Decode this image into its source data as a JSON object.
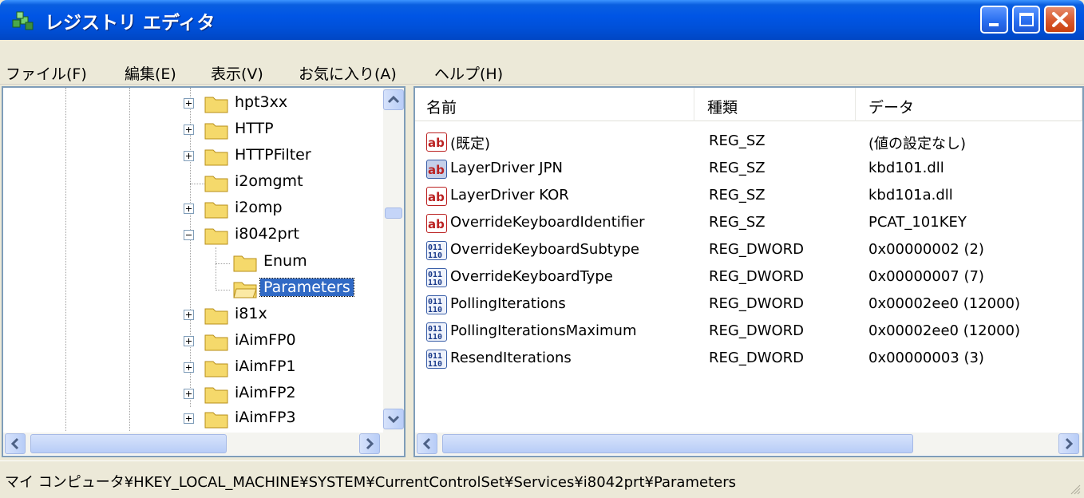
{
  "window": {
    "title": "レジストリ エディタ"
  },
  "menu": {
    "file": "ファイル(F)",
    "edit": "編集(E)",
    "view": "表示(V)",
    "favorites": "お気に入り(A)",
    "help": "ヘルプ(H)"
  },
  "tree": {
    "items": [
      {
        "label": "hpt3xx",
        "expander": "plus"
      },
      {
        "label": "HTTP",
        "expander": "plus"
      },
      {
        "label": "HTTPFilter",
        "expander": "plus"
      },
      {
        "label": "i2omgmt",
        "expander": "none"
      },
      {
        "label": "i2omp",
        "expander": "plus"
      },
      {
        "label": "i8042prt",
        "expander": "minus"
      },
      {
        "label": "Enum",
        "expander": "none"
      },
      {
        "label": "Parameters",
        "expander": "none",
        "selected": true
      },
      {
        "label": "i81x",
        "expander": "plus"
      },
      {
        "label": "iAimFP0",
        "expander": "plus"
      },
      {
        "label": "iAimFP1",
        "expander": "plus"
      },
      {
        "label": "iAimFP2",
        "expander": "plus"
      },
      {
        "label": "iAimFP3",
        "expander": "plus"
      }
    ]
  },
  "list": {
    "columns": {
      "name": "名前",
      "type": "種類",
      "data": "データ"
    },
    "rows": [
      {
        "icon": "string-value-icon",
        "name": "(既定)",
        "type": "REG_SZ",
        "data": "(値の設定なし)"
      },
      {
        "icon": "string-value-icon",
        "name": "LayerDriver JPN",
        "type": "REG_SZ",
        "data": "kbd101.dll"
      },
      {
        "icon": "string-value-icon",
        "name": "LayerDriver KOR",
        "type": "REG_SZ",
        "data": "kbd101a.dll"
      },
      {
        "icon": "string-value-icon",
        "name": "OverrideKeyboardIdentifier",
        "type": "REG_SZ",
        "data": "PCAT_101KEY"
      },
      {
        "icon": "binary-value-icon",
        "name": "OverrideKeyboardSubtype",
        "type": "REG_DWORD",
        "data": "0x00000002 (2)"
      },
      {
        "icon": "binary-value-icon",
        "name": "OverrideKeyboardType",
        "type": "REG_DWORD",
        "data": "0x00000007 (7)"
      },
      {
        "icon": "binary-value-icon",
        "name": "PollingIterations",
        "type": "REG_DWORD",
        "data": "0x00002ee0 (12000)"
      },
      {
        "icon": "binary-value-icon",
        "name": "PollingIterationsMaximum",
        "type": "REG_DWORD",
        "data": "0x00002ee0 (12000)"
      },
      {
        "icon": "binary-value-icon",
        "name": "ResendIterations",
        "type": "REG_DWORD",
        "data": "0x00000003 (3)"
      }
    ]
  },
  "status": {
    "path": "マイ コンピュータ¥HKEY_LOCAL_MACHINE¥SYSTEM¥CurrentControlSet¥Services¥i8042prt¥Parameters"
  },
  "colors": {
    "titlebar": "#0055e5",
    "selection": "#316ac5",
    "folder": "#f5d96b",
    "close_button": "#d8582d"
  }
}
